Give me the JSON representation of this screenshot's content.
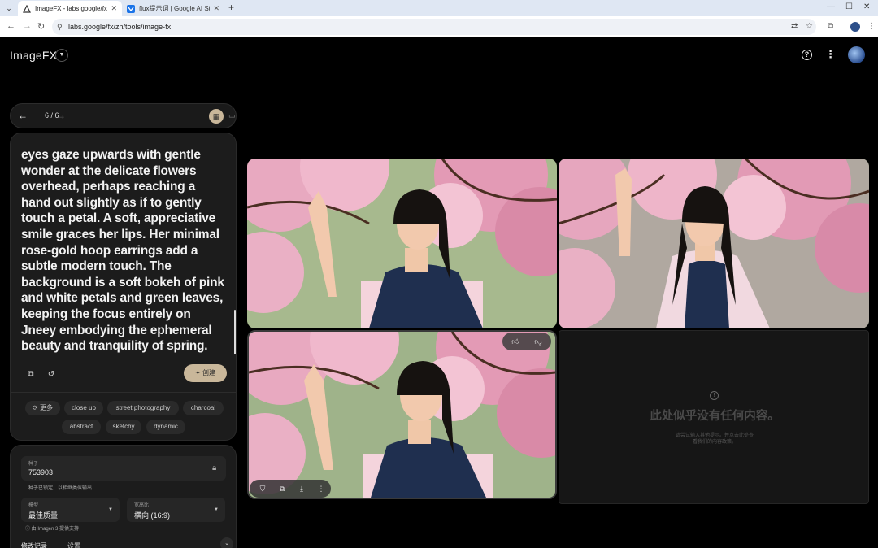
{
  "browser": {
    "tabs": [
      {
        "title": "ImageFX - labs.google/fx",
        "active": true
      },
      {
        "title": "flux提示词 | Google AI Studio",
        "active": false
      }
    ],
    "url": "labs.google/fx/zh/tools/image-fx"
  },
  "app": {
    "title": "ImageFX"
  },
  "navigator": {
    "counter": "6 / 6"
  },
  "prompt": {
    "text": "eyes gaze upwards with gentle wonder at the delicate flowers overhead, perhaps reaching a hand out slightly as if to gently touch a petal. A soft, appreciative smile graces her lips. Her minimal rose-gold hoop earrings add a subtle modern touch. The background is a soft bokeh of pink and white petals and green leaves, keeping the focus entirely on Jneey embodying the ephemeral beauty and tranquility of spring.",
    "create_label": "创建"
  },
  "chips": {
    "more_label": "更多",
    "items": [
      "close up",
      "street photography",
      "charcoal",
      "abstract",
      "sketchy",
      "dynamic"
    ]
  },
  "settings": {
    "seed_label": "种子",
    "seed_value": "753903",
    "seed_help": "种子已锁定，以相继类似输出",
    "model_label": "模型",
    "model_value": "最佳质量",
    "aspect_label": "宽高比",
    "aspect_value": "横向 (16:9)",
    "powered_by": "由 Imagen 3 提供支持",
    "tab_history": "修改记录",
    "tab_settings": "设置"
  },
  "empty_state": {
    "headline": "此处似乎没有任何内容。",
    "sub_line1": "请尝试输入其他提示。并点击此处查",
    "sub_line2": "看我们的内容政策。"
  },
  "colors": {
    "accent": "#c9b79a",
    "background": "#000000",
    "card": "#1c1c1c"
  }
}
